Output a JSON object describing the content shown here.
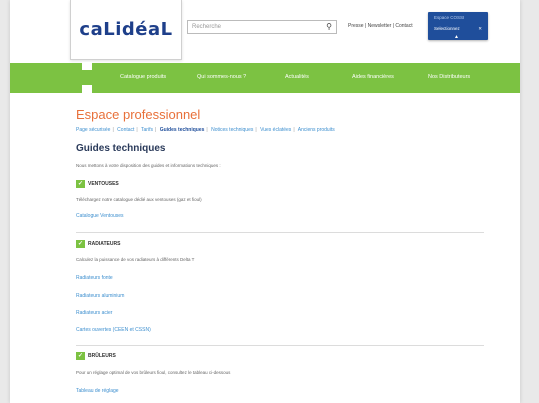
{
  "header": {
    "logo_text": "caLidéaL",
    "search_placeholder": "Recherche",
    "top_links": [
      "Presse",
      "Newsletter",
      "Contact"
    ],
    "pro_box_title": "Espace COSSI",
    "pro_box_select": "Selectionnez"
  },
  "nav": {
    "items": [
      "Catalogue produits",
      "Qui sommes-nous ?",
      "Actualités",
      "Aides financières",
      "Nos Distributeurs"
    ]
  },
  "page": {
    "title": "Espace professionnel",
    "breadcrumb": [
      "Page sécurisée",
      "Contact",
      "Tarifs",
      "Guides techniques",
      "Notices techniques",
      "Vues éclatées",
      "Anciens produits"
    ],
    "breadcrumb_active_index": 3,
    "heading": "Guides techniques",
    "intro": "Nous mettons à votre disposition des guides et informations techniques :"
  },
  "sections": [
    {
      "title": "VENTOUSES",
      "description": "Téléchargez notre catalogue dédié aux ventouses (gaz et fioul)",
      "links": [
        "Catalogue Ventouses"
      ]
    },
    {
      "title": "RADIATEURS",
      "description": "Calculez la puissance de vos radiateurs à différents Delta T",
      "links": [
        "Radiateurs fonte",
        "Radiateurs aluminium",
        "Radiateurs acier",
        "Cartes ouvertes (CEEN et CSSN)"
      ]
    },
    {
      "title": "BRÛLEURS",
      "description": "Pour un réglage optimal de vos brûleurs fioul, consultez le tableau ci-dessous",
      "links": [
        "Tableau de réglage"
      ]
    }
  ],
  "colors": {
    "nav_green": "#7cc242",
    "title_orange": "#e8703a",
    "brand_blue": "#1f4e9b",
    "link_blue": "#3d8fcf"
  }
}
